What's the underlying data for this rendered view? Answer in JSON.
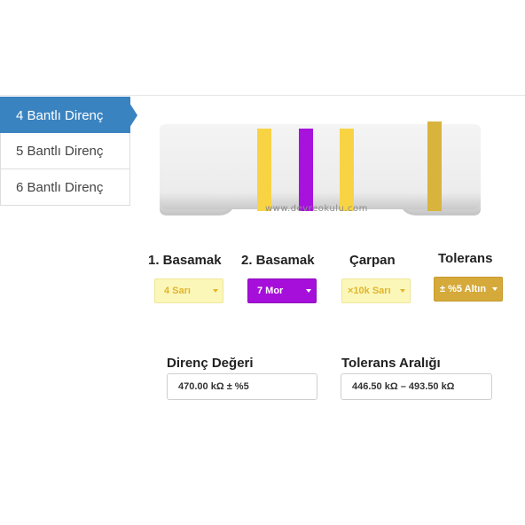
{
  "tabs": [
    {
      "label": "4 Bantlı Direnç",
      "active": true
    },
    {
      "label": "5 Bantlı Direnç",
      "active": false
    },
    {
      "label": "6 Bantlı Direnç",
      "active": false
    }
  ],
  "resistor": {
    "watermark": "www.devreokulu.com",
    "body_color": "#ececec",
    "band_colors": [
      "#f8d445",
      "#a712dc",
      "#f8d445",
      "#d8b43d"
    ]
  },
  "selectors": [
    {
      "label": "1. Basamak",
      "value": "4 Sarı",
      "bg": "#fbf7b9",
      "fg": "#e2b52b",
      "border": "#efe69a"
    },
    {
      "label": "2. Basamak",
      "value": "7 Mor",
      "bg": "#a60fd9",
      "fg": "#ffffff",
      "border": "#8f0bbd"
    },
    {
      "label": "Çarpan",
      "value": "×10k Sarı",
      "bg": "#fbf7b9",
      "fg": "#e2b52b",
      "border": "#efe69a"
    },
    {
      "label": "Tolerans",
      "value": "± %5 Altın",
      "bg": "#d5aa3a",
      "fg": "#ffffff",
      "border": "#c69b2d"
    }
  ],
  "results": {
    "value_label": "Direnç Değeri",
    "value_text": "470.00 kΩ ± %5",
    "range_label": "Tolerans Aralığı",
    "range_text": "446.50 kΩ  –  493.50 kΩ"
  }
}
